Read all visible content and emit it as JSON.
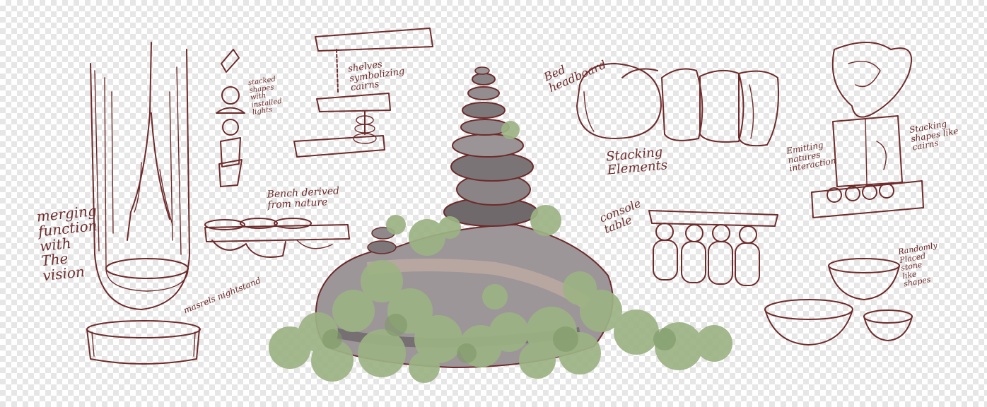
{
  "colors": {
    "ink": "#6e2b2b",
    "moss": "#9cb384",
    "stone": "#9d9699",
    "stone_dark": "#4f4a4c"
  },
  "notes": {
    "merging_function": "merging\nfunction\nwith\nThe\nvision",
    "nightstand": "masrels nightstand",
    "stacked_shapes": "stacked\nshapes\nwith\ninstalled\nlights",
    "shelves": "shelves\nsymbolizing\ncairns",
    "bench": "Bench derived\nfrom nature",
    "bed_headboard": "Bed\nheadboard",
    "stacking_elements": "Stacking\nElements",
    "console_table": "console\ntable",
    "emitting": "Emitting\nnatures\ninteraction",
    "stacking_shapes": "Stacking\nshapes like\ncairns",
    "randomly_placed": "Randomly\nPlaced\nstone\nlike\nshapes"
  }
}
